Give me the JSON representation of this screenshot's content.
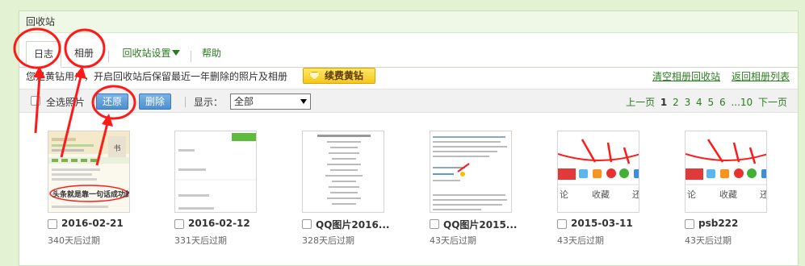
{
  "panel": {
    "title": "回收站"
  },
  "tabs": [
    {
      "label": "日志"
    },
    {
      "label": "相册"
    },
    {
      "label": "回收站设置"
    },
    {
      "label": "帮助"
    }
  ],
  "notice": {
    "text": "您是黄钻用户，开启回收站后保留最近一年删除的照片及相册",
    "renew_label": "续费黄钻",
    "clear_link": "清空相册回收站",
    "back_link": "返回相册列表"
  },
  "toolbar": {
    "select_all": "全选照片",
    "restore": "还原",
    "delete": "删除",
    "show_label": "显示：",
    "show_value": "全部"
  },
  "pager": {
    "prev": "上一页",
    "pages": [
      "1",
      "2",
      "3",
      "4",
      "5",
      "6"
    ],
    "ellipsis": "...10",
    "next": "下一页"
  },
  "photos": [
    {
      "name": "2016-02-21",
      "expire": "340天后过期",
      "caption": "头条就是靠一句话成功的"
    },
    {
      "name": "2016-02-12",
      "expire": "331天后过期"
    },
    {
      "name": "QQ图片2016...",
      "expire": "328天后过期"
    },
    {
      "name": "QQ图片2015...",
      "expire": "43天后过期"
    },
    {
      "name": "2015-03-11",
      "expire": "43天后过期",
      "strip_left": "论",
      "strip_mid": "收藏",
      "strip_right": "还"
    },
    {
      "name": "psb222",
      "expire": "43天后过期",
      "strip_left": "论",
      "strip_mid": "收藏",
      "strip_right": "还"
    }
  ],
  "colors": {
    "background": "#e3f2d3",
    "link": "#2a7c1e",
    "button": "#4f8fcf",
    "annotation": "#ff1a1a"
  }
}
